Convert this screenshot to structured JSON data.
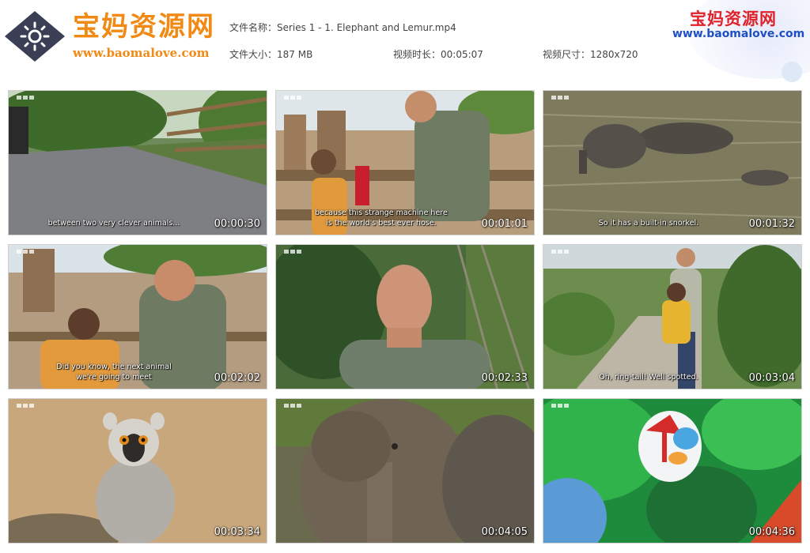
{
  "brand": {
    "name_cn": "宝妈资源网",
    "url": "www.baomalove.com"
  },
  "watermark": {
    "name_cn": "宝妈资源网",
    "url": "www.baomalove.com"
  },
  "file_info": {
    "name": "文件名称：Series 1 - 1. Elephant and Lemur.mp4",
    "size": "文件大小：187 MB",
    "duration": "视频时长：00:05:07",
    "dimensions": "视频尺寸：1280x720"
  },
  "thumbnails": [
    {
      "time": "00:00:30",
      "subtitle": "between two very clever animals...",
      "scene": "zoo-path"
    },
    {
      "time": "00:01:01",
      "subtitle": "because this strange machine here\nis the world's best ever hose.",
      "scene": "man-boy-machine"
    },
    {
      "time": "00:01:32",
      "subtitle": "So it has a built-in snorkel.",
      "scene": "elephant-swimming"
    },
    {
      "time": "00:02:02",
      "subtitle": "Did you know, the next animal\nwe're going to meet",
      "scene": "man-boy-enclosure"
    },
    {
      "time": "00:02:33",
      "subtitle": "",
      "scene": "presenter-closeup"
    },
    {
      "time": "00:03:04",
      "subtitle": "Oh, ring-tail! Well spotted.",
      "scene": "man-boy-garden"
    },
    {
      "time": "00:03:34",
      "subtitle": "",
      "scene": "lemur"
    },
    {
      "time": "00:04:05",
      "subtitle": "",
      "scene": "elephant-closeup"
    },
    {
      "time": "00:04:36",
      "subtitle": "",
      "scene": "jungle-logo"
    }
  ],
  "colors": {
    "brand_orange": "#f08a14",
    "watermark_red": "#e0232b",
    "watermark_blue": "#1f4fc4",
    "logo_badge": "#3a3f55"
  }
}
